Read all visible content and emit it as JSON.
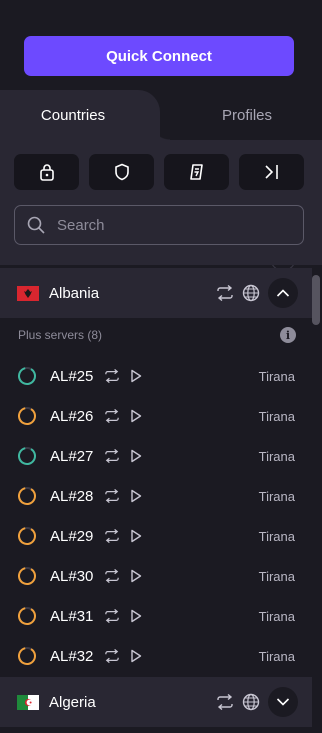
{
  "header": {
    "quick_connect_label": "Quick Connect"
  },
  "tabs": [
    {
      "label": "Countries",
      "active": true
    },
    {
      "label": "Profiles",
      "active": false
    }
  ],
  "filters": [
    "lock-icon",
    "shield-icon",
    "p2p-icon",
    "tor-icon"
  ],
  "search": {
    "placeholder": "Search",
    "value": ""
  },
  "countries": [
    {
      "name": "Albania",
      "expanded": true,
      "group_label": "Plus servers (8)",
      "servers": [
        {
          "name": "AL#25",
          "city": "Tirana",
          "load_color": "#3fb8a0"
        },
        {
          "name": "AL#26",
          "city": "Tirana",
          "load_color": "#f1a13c"
        },
        {
          "name": "AL#27",
          "city": "Tirana",
          "load_color": "#3fb8a0"
        },
        {
          "name": "AL#28",
          "city": "Tirana",
          "load_color": "#f1a13c"
        },
        {
          "name": "AL#29",
          "city": "Tirana",
          "load_color": "#f1a13c"
        },
        {
          "name": "AL#30",
          "city": "Tirana",
          "load_color": "#f1a13c"
        },
        {
          "name": "AL#31",
          "city": "Tirana",
          "load_color": "#f1a13c"
        },
        {
          "name": "AL#32",
          "city": "Tirana",
          "load_color": "#f1a13c"
        }
      ]
    },
    {
      "name": "Algeria",
      "expanded": false
    }
  ],
  "colors": {
    "accent": "#6d4aff",
    "load_low": "#3fb8a0",
    "load_mid": "#f1a13c"
  }
}
